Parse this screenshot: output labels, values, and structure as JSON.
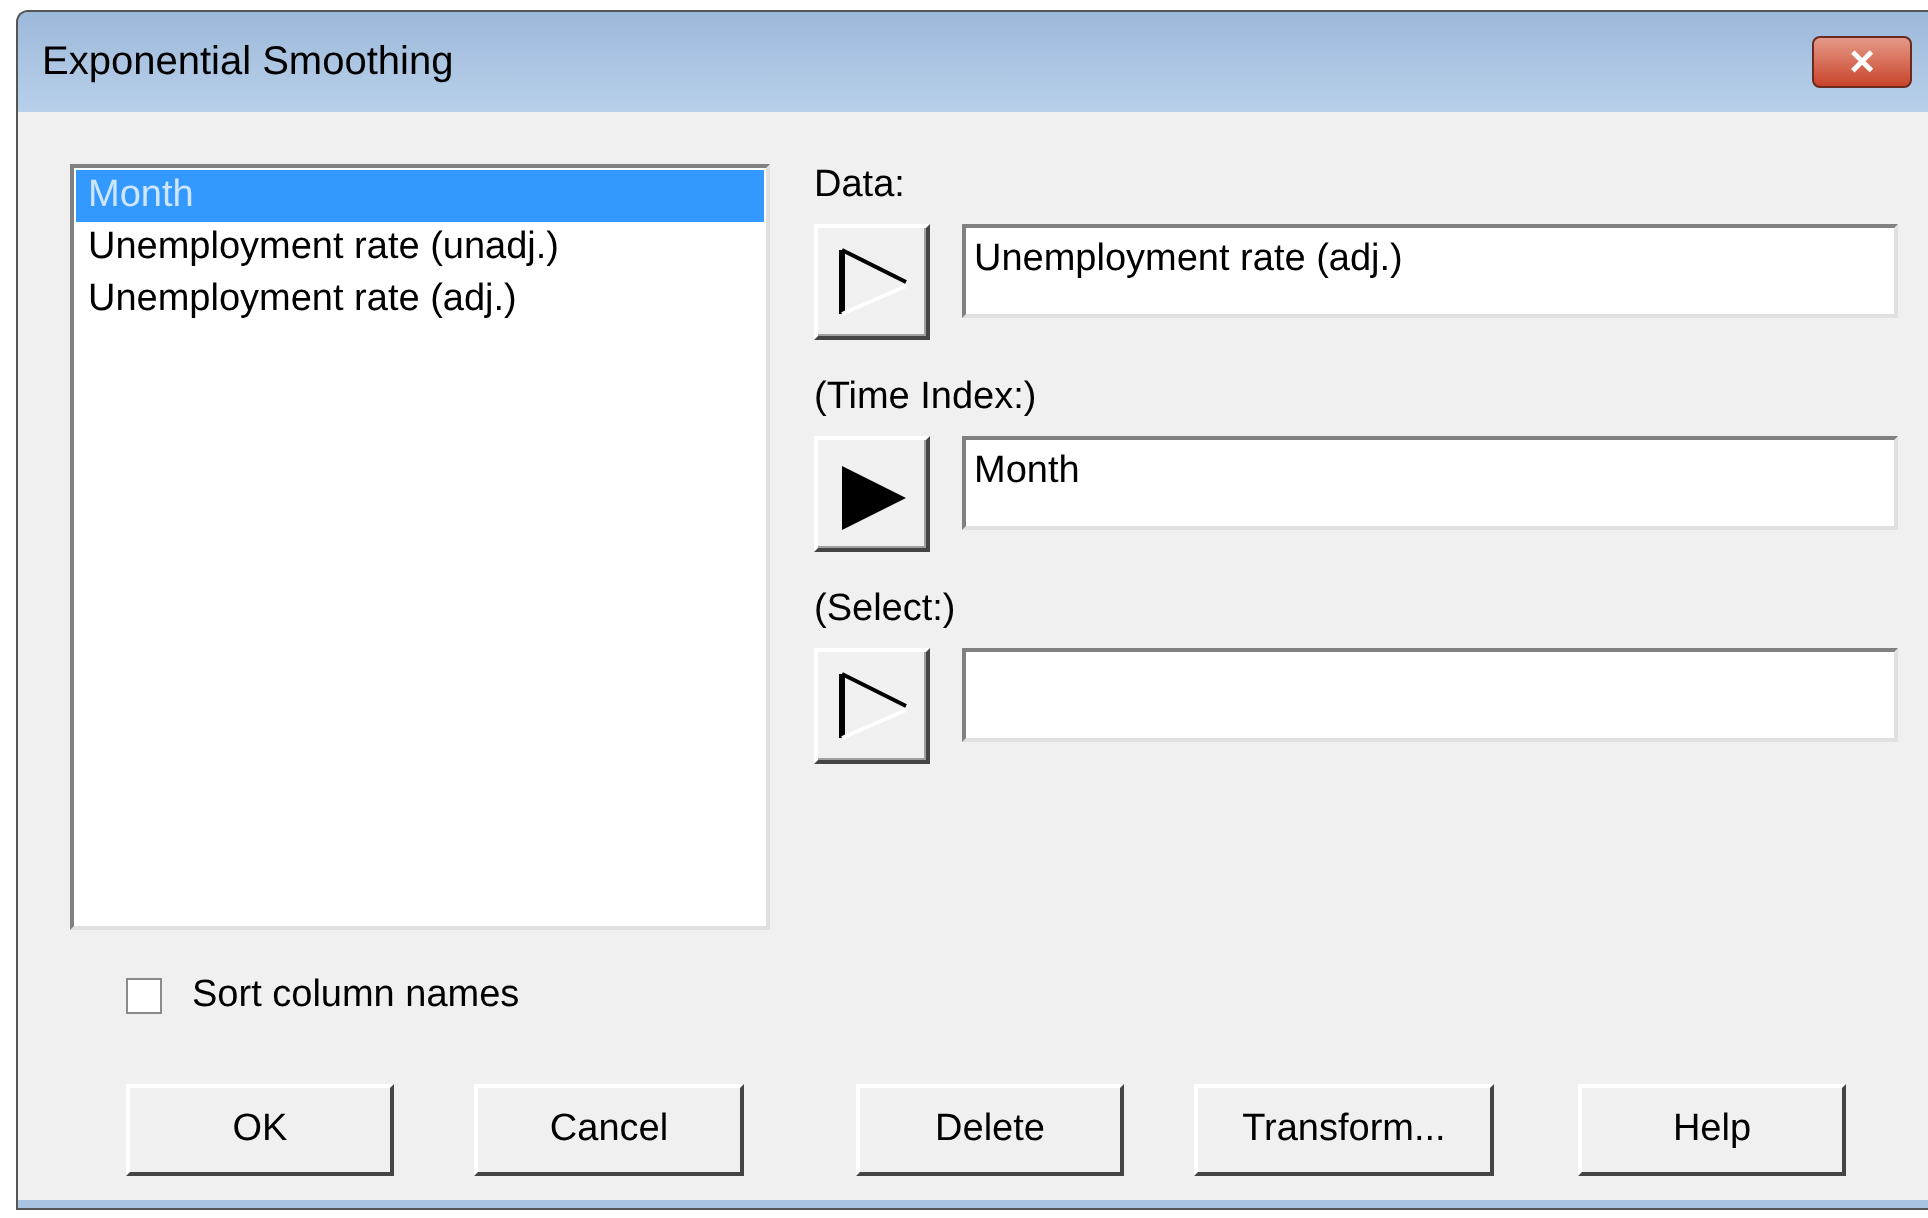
{
  "window": {
    "title": "Exponential Smoothing",
    "close": "×"
  },
  "columns": [
    {
      "label": "Month",
      "selected": true
    },
    {
      "label": "Unemployment rate (unadj.)",
      "selected": false
    },
    {
      "label": "Unemployment rate (adj.)",
      "selected": false
    }
  ],
  "inputs": [
    {
      "label": "Data:",
      "kind": "outline",
      "value": "Unemployment rate (adj.)"
    },
    {
      "label": "(Time Index:)",
      "kind": "filled",
      "value": "Month"
    },
    {
      "label": "(Select:)",
      "kind": "outline"
    }
  ],
  "sort_column_names": {
    "label": "Sort column names",
    "checked": false
  },
  "buttons": [
    "OK",
    "Cancel",
    "Delete",
    "Transform...",
    "Help"
  ]
}
